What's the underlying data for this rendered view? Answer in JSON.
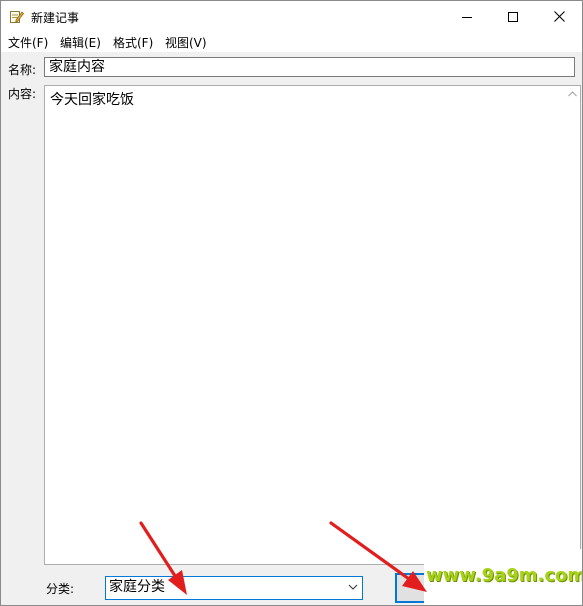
{
  "window": {
    "title": "新建记事"
  },
  "menu": [
    "文件(F)",
    "编辑(E)",
    "格式(F)",
    "视图(V)"
  ],
  "form": {
    "name_label": "名称:",
    "name_value": "家庭内容",
    "content_label": "内容:",
    "content_value": "今天回家吃饭",
    "category_label": "分类:",
    "category_value": "家庭分类"
  },
  "watermark": "www.9a9m.com",
  "colors": {
    "accent": "#0078d7",
    "arrow": "#e21d1d",
    "watermark": "#a7d21a"
  }
}
